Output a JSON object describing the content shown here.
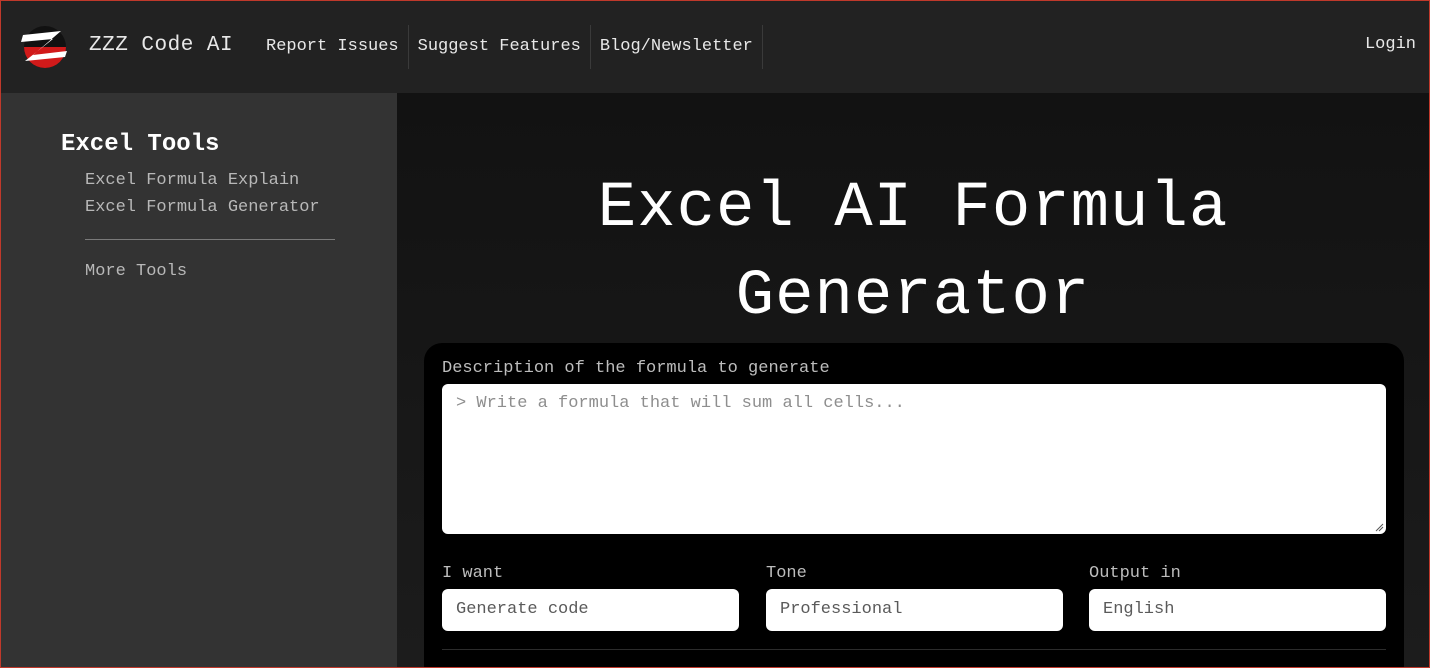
{
  "header": {
    "brand": "ZZZ Code AI",
    "nav": [
      "Report Issues",
      "Suggest Features",
      "Blog/Newsletter"
    ],
    "login": "Login",
    "colors": {
      "logo_red": "#d11a1a",
      "logo_black": "#111111"
    }
  },
  "sidebar": {
    "heading": "Excel Tools",
    "items": [
      "Excel Formula Explain",
      "Excel Formula Generator"
    ],
    "more": "More Tools"
  },
  "main": {
    "title_line1": "Excel AI Formula",
    "title_line2": "Generator",
    "form": {
      "description_label": "Description of the formula to generate",
      "description_placeholder": "> Write a formula that will sum all cells...",
      "want_label": "I want",
      "want_value": "Generate code",
      "tone_label": "Tone",
      "tone_value": "Professional",
      "output_label": "Output in",
      "output_value": "English"
    }
  }
}
